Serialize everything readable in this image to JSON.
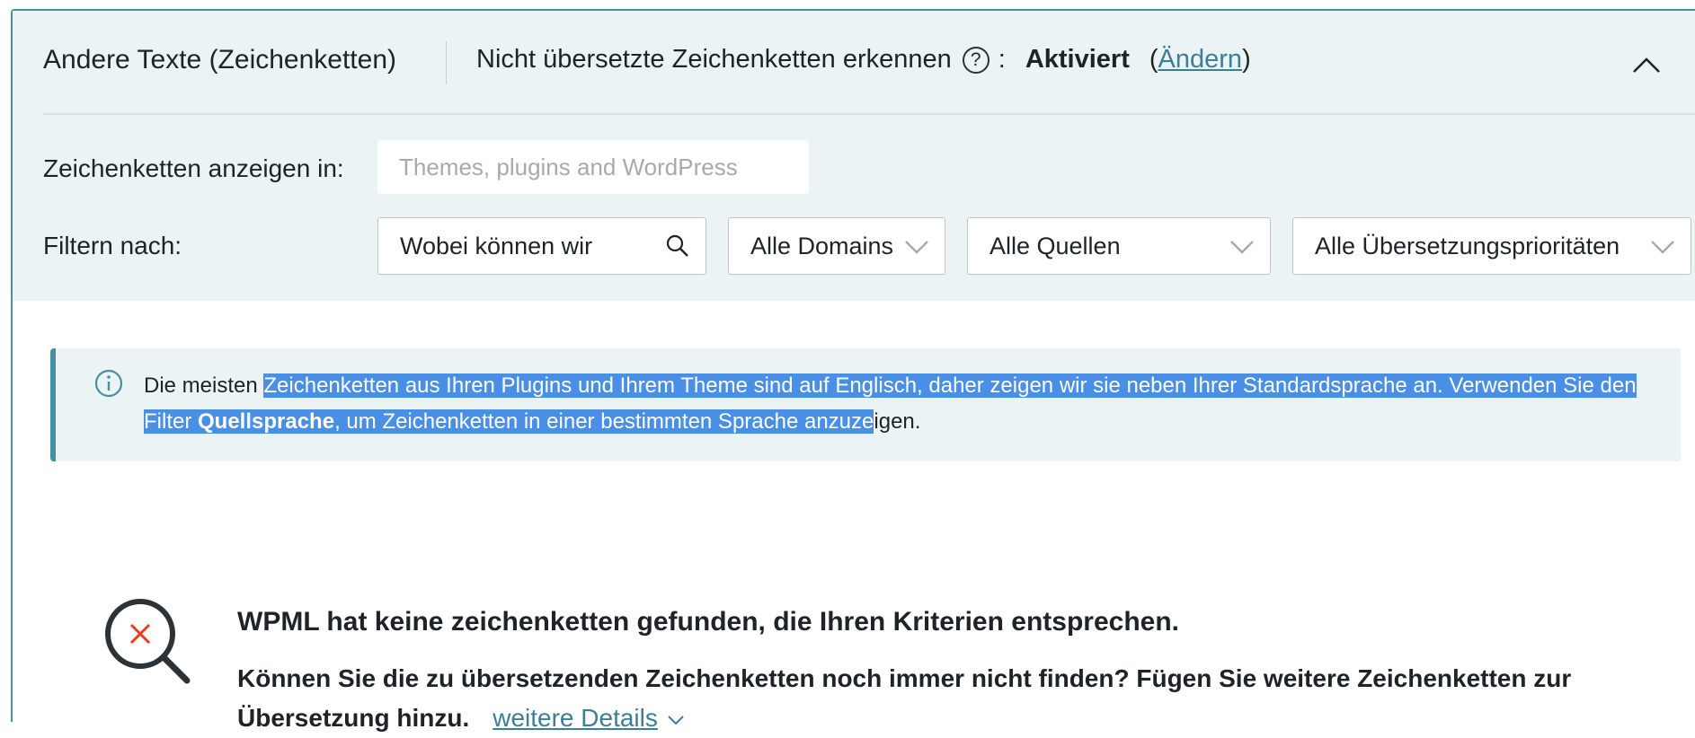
{
  "section": {
    "title": "Andere Texte (Zeichenketten)",
    "detect_label": "Nicht übersetzte Zeichenketten erkennen",
    "help_symbol": "?",
    "colon": ":",
    "status": "Aktiviert",
    "paren_open": "(",
    "change_link": "Ändern",
    "paren_close": ")"
  },
  "show_strings": {
    "label": "Zeichenketten anzeigen in:",
    "placeholder": "Themes, plugins and WordPress"
  },
  "filters": {
    "label": "Filtern nach:",
    "search_value": "Wobei können wir",
    "domains": "Alle Domains",
    "sources": "Alle Quellen",
    "priorities": "Alle Übersetzungsprioritäten"
  },
  "notice": {
    "part1": "Die meisten ",
    "part2_selected": "Zeichenketten aus Ihren Plugins und Ihrem Theme sind auf Englisch, daher zeigen wir sie neben Ihrer Standardsprache an. Verwenden Sie den Filter ",
    "bold_selected": "Quellsprache",
    "part3_selected": ", um Zeichenketten in einer bestimmten Sprache anzuze",
    "part4": "igen."
  },
  "empty_state": {
    "title": "WPML hat keine zeichenketten gefunden, die Ihren Kriterien entsprechen.",
    "subtitle": "Können Sie die zu übersetzenden Zeichenketten noch immer nicht finden? Fügen Sie weitere Zeichenketten zur Übersetzung hinzu.",
    "more_link": "weitere Details"
  },
  "colors": {
    "accent": "#4a8fa0",
    "link": "#3b7f95",
    "header_bg": "#ebf3f5",
    "selection": "#4a8fe6",
    "empty_icon_x": "#e2401c"
  },
  "icons": {
    "help": "question-circle-icon",
    "collapse": "chevron-up-icon",
    "search": "search-icon",
    "dropdown": "chevron-down-icon",
    "info": "info-circle-icon",
    "empty": "magnifier-x-icon"
  }
}
